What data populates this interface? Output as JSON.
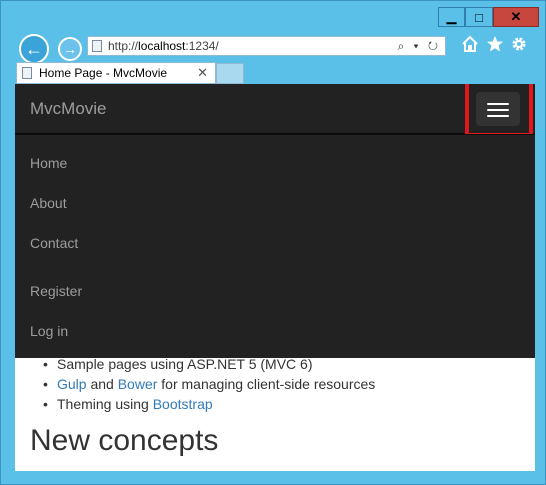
{
  "window": {
    "minimize_glyph": "▁",
    "maximize_glyph": "□",
    "close_glyph": "✕"
  },
  "browser": {
    "back_glyph": "←",
    "forward_glyph": "→",
    "address": {
      "prefix": "http://",
      "host": "localhost",
      "rest": ":1234/"
    },
    "search_glyph": "⌕ ▾ ↻",
    "icons": [
      "home-icon",
      "favorites-icon",
      "settings-icon"
    ],
    "tab": {
      "title": "Home Page - MvcMovie",
      "close_glyph": "✕"
    }
  },
  "site": {
    "brand": "MvcMovie",
    "menu": [
      "Home",
      "About",
      "Contact",
      "Register",
      "Log in"
    ],
    "bullets": [
      {
        "text": "Sample pages using ASP.NET 5 (MVC 6)"
      },
      {
        "link": "Gulp",
        "mid": " and ",
        "link2": "Bower",
        "rest": " for managing client-side resources"
      },
      {
        "pre": "Theming using ",
        "link": "Bootstrap"
      }
    ],
    "heading": "New concepts"
  },
  "colors": {
    "navbar": "#222222",
    "highlight": "#e0161d",
    "link": "#337ab7",
    "chrome": "#5bc0e8"
  }
}
